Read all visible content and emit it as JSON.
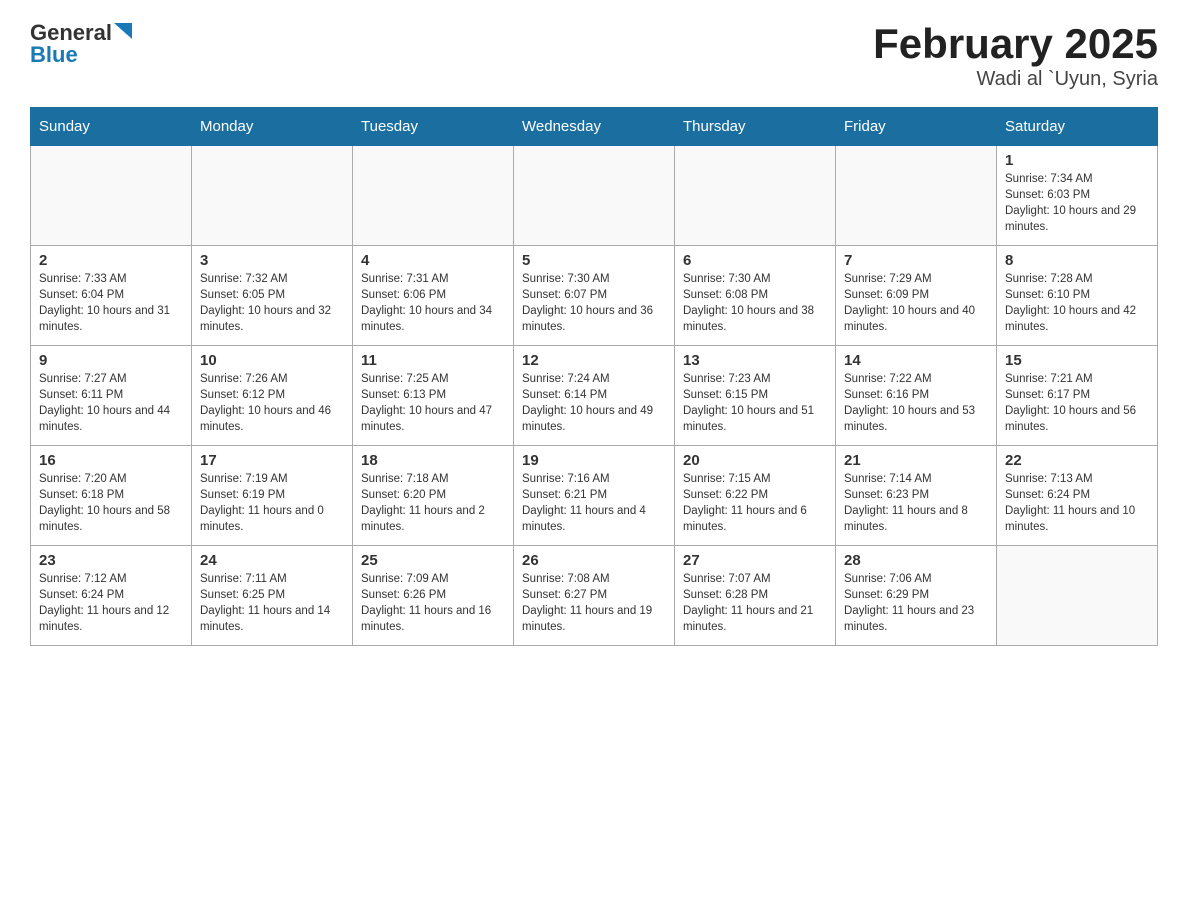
{
  "header": {
    "logo_general": "General",
    "logo_blue": "Blue",
    "title": "February 2025",
    "subtitle": "Wadi al `Uyun, Syria"
  },
  "weekdays": [
    "Sunday",
    "Monday",
    "Tuesday",
    "Wednesday",
    "Thursday",
    "Friday",
    "Saturday"
  ],
  "weeks": [
    [
      {
        "day": "",
        "info": ""
      },
      {
        "day": "",
        "info": ""
      },
      {
        "day": "",
        "info": ""
      },
      {
        "day": "",
        "info": ""
      },
      {
        "day": "",
        "info": ""
      },
      {
        "day": "",
        "info": ""
      },
      {
        "day": "1",
        "info": "Sunrise: 7:34 AM\nSunset: 6:03 PM\nDaylight: 10 hours and 29 minutes."
      }
    ],
    [
      {
        "day": "2",
        "info": "Sunrise: 7:33 AM\nSunset: 6:04 PM\nDaylight: 10 hours and 31 minutes."
      },
      {
        "day": "3",
        "info": "Sunrise: 7:32 AM\nSunset: 6:05 PM\nDaylight: 10 hours and 32 minutes."
      },
      {
        "day": "4",
        "info": "Sunrise: 7:31 AM\nSunset: 6:06 PM\nDaylight: 10 hours and 34 minutes."
      },
      {
        "day": "5",
        "info": "Sunrise: 7:30 AM\nSunset: 6:07 PM\nDaylight: 10 hours and 36 minutes."
      },
      {
        "day": "6",
        "info": "Sunrise: 7:30 AM\nSunset: 6:08 PM\nDaylight: 10 hours and 38 minutes."
      },
      {
        "day": "7",
        "info": "Sunrise: 7:29 AM\nSunset: 6:09 PM\nDaylight: 10 hours and 40 minutes."
      },
      {
        "day": "8",
        "info": "Sunrise: 7:28 AM\nSunset: 6:10 PM\nDaylight: 10 hours and 42 minutes."
      }
    ],
    [
      {
        "day": "9",
        "info": "Sunrise: 7:27 AM\nSunset: 6:11 PM\nDaylight: 10 hours and 44 minutes."
      },
      {
        "day": "10",
        "info": "Sunrise: 7:26 AM\nSunset: 6:12 PM\nDaylight: 10 hours and 46 minutes."
      },
      {
        "day": "11",
        "info": "Sunrise: 7:25 AM\nSunset: 6:13 PM\nDaylight: 10 hours and 47 minutes."
      },
      {
        "day": "12",
        "info": "Sunrise: 7:24 AM\nSunset: 6:14 PM\nDaylight: 10 hours and 49 minutes."
      },
      {
        "day": "13",
        "info": "Sunrise: 7:23 AM\nSunset: 6:15 PM\nDaylight: 10 hours and 51 minutes."
      },
      {
        "day": "14",
        "info": "Sunrise: 7:22 AM\nSunset: 6:16 PM\nDaylight: 10 hours and 53 minutes."
      },
      {
        "day": "15",
        "info": "Sunrise: 7:21 AM\nSunset: 6:17 PM\nDaylight: 10 hours and 56 minutes."
      }
    ],
    [
      {
        "day": "16",
        "info": "Sunrise: 7:20 AM\nSunset: 6:18 PM\nDaylight: 10 hours and 58 minutes."
      },
      {
        "day": "17",
        "info": "Sunrise: 7:19 AM\nSunset: 6:19 PM\nDaylight: 11 hours and 0 minutes."
      },
      {
        "day": "18",
        "info": "Sunrise: 7:18 AM\nSunset: 6:20 PM\nDaylight: 11 hours and 2 minutes."
      },
      {
        "day": "19",
        "info": "Sunrise: 7:16 AM\nSunset: 6:21 PM\nDaylight: 11 hours and 4 minutes."
      },
      {
        "day": "20",
        "info": "Sunrise: 7:15 AM\nSunset: 6:22 PM\nDaylight: 11 hours and 6 minutes."
      },
      {
        "day": "21",
        "info": "Sunrise: 7:14 AM\nSunset: 6:23 PM\nDaylight: 11 hours and 8 minutes."
      },
      {
        "day": "22",
        "info": "Sunrise: 7:13 AM\nSunset: 6:24 PM\nDaylight: 11 hours and 10 minutes."
      }
    ],
    [
      {
        "day": "23",
        "info": "Sunrise: 7:12 AM\nSunset: 6:24 PM\nDaylight: 11 hours and 12 minutes."
      },
      {
        "day": "24",
        "info": "Sunrise: 7:11 AM\nSunset: 6:25 PM\nDaylight: 11 hours and 14 minutes."
      },
      {
        "day": "25",
        "info": "Sunrise: 7:09 AM\nSunset: 6:26 PM\nDaylight: 11 hours and 16 minutes."
      },
      {
        "day": "26",
        "info": "Sunrise: 7:08 AM\nSunset: 6:27 PM\nDaylight: 11 hours and 19 minutes."
      },
      {
        "day": "27",
        "info": "Sunrise: 7:07 AM\nSunset: 6:28 PM\nDaylight: 11 hours and 21 minutes."
      },
      {
        "day": "28",
        "info": "Sunrise: 7:06 AM\nSunset: 6:29 PM\nDaylight: 11 hours and 23 minutes."
      },
      {
        "day": "",
        "info": ""
      }
    ]
  ]
}
